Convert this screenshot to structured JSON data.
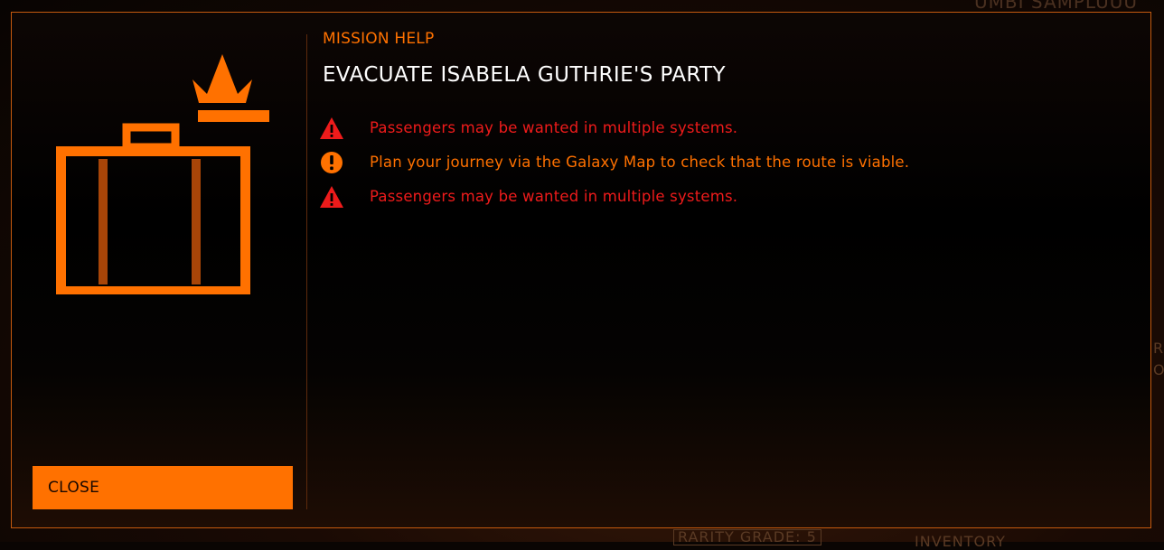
{
  "background": {
    "fragment_top": "UMBI SAMPLUUU",
    "fragment_bottom": "RARITY GRADE: 5",
    "fragment_bottom2": "INVENTORY",
    "fragment_right1": "R",
    "fragment_right2": "OV"
  },
  "dialog": {
    "section_label": "MISSION HELP",
    "title": "EVACUATE ISABELA GUTHRIE'S PARTY",
    "icon": "briefcase-crown-icon",
    "close_label": "CLOSE",
    "notices": [
      {
        "type": "warning",
        "icon": "warning-triangle-icon",
        "text": "Passengers may be wanted in multiple systems."
      },
      {
        "type": "info",
        "icon": "exclamation-circle-icon",
        "text": "Plan your journey via the Galaxy Map to check that the route is viable."
      },
      {
        "type": "warning",
        "icon": "warning-triangle-icon",
        "text": "Passengers may be wanted in multiple systems."
      }
    ]
  },
  "colors": {
    "accent": "#ff7100",
    "warning": "#ee1b1b",
    "title": "#ffffff",
    "border": "#c4590e"
  }
}
